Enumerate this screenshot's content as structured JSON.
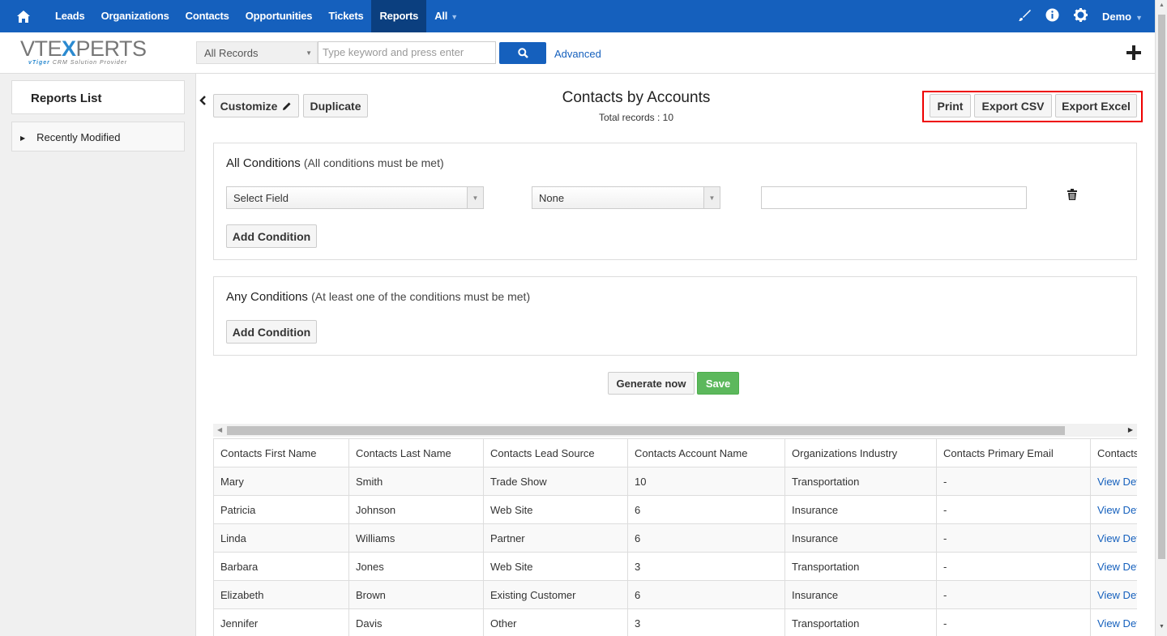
{
  "nav": {
    "items": [
      "Leads",
      "Organizations",
      "Contacts",
      "Opportunities",
      "Tickets",
      "Reports",
      "All"
    ],
    "active": "Reports",
    "user": "Demo"
  },
  "logo": {
    "main_pre": "VTE",
    "main_x": "X",
    "main_post": "PERTS",
    "tag_brand": "vTiger",
    "tag_text": "CRM Solution Provider"
  },
  "search": {
    "records_filter": "All Records",
    "placeholder": "Type keyword and press enter",
    "advanced_label": "Advanced"
  },
  "sidebar": {
    "title": "Reports List",
    "items": [
      {
        "label": "Recently Modified"
      }
    ]
  },
  "report": {
    "title": "Contacts by Accounts",
    "total": "Total records : 10",
    "customize_label": "Customize",
    "duplicate_label": "Duplicate",
    "print_label": "Print",
    "export_csv_label": "Export CSV",
    "export_excel_label": "Export Excel"
  },
  "all_conditions": {
    "title": "All Conditions",
    "note": "(All conditions must be met)",
    "field_select": "Select Field",
    "operator_select": "None",
    "value": "",
    "add_label": "Add Condition"
  },
  "any_conditions": {
    "title": "Any Conditions",
    "note": "(At least one of the conditions must be met)",
    "add_label": "Add Condition"
  },
  "actions": {
    "generate_label": "Generate now",
    "save_label": "Save"
  },
  "table": {
    "columns": [
      "Contacts First Name",
      "Contacts Last Name",
      "Contacts Lead Source",
      "Contacts Account Name",
      "Organizations Industry",
      "Contacts Primary Email",
      "Contacts"
    ],
    "rows": [
      [
        "Mary",
        "Smith",
        "Trade Show",
        "10",
        "Transportation",
        "-",
        "View Det"
      ],
      [
        "Patricia",
        "Johnson",
        "Web Site",
        "6",
        "Insurance",
        "-",
        "View Det"
      ],
      [
        "Linda",
        "Williams",
        "Partner",
        "6",
        "Insurance",
        "-",
        "View Det"
      ],
      [
        "Barbara",
        "Jones",
        "Web Site",
        "3",
        "Transportation",
        "-",
        "View Det"
      ],
      [
        "Elizabeth",
        "Brown",
        "Existing Customer",
        "6",
        "Insurance",
        "-",
        "View Det"
      ],
      [
        "Jennifer",
        "Davis",
        "Other",
        "3",
        "Transportation",
        "-",
        "View Det"
      ]
    ]
  },
  "colors": {
    "nav_bg": "#1560bd",
    "nav_active": "#0b3f7f",
    "save_green": "#5cb85c",
    "highlight_red": "#ee0000"
  },
  "icons": [
    "home-icon",
    "brush-icon",
    "info-icon",
    "gear-icon",
    "search-icon",
    "plus-icon",
    "pencil-icon",
    "trash-icon",
    "chevron-left-icon"
  ]
}
